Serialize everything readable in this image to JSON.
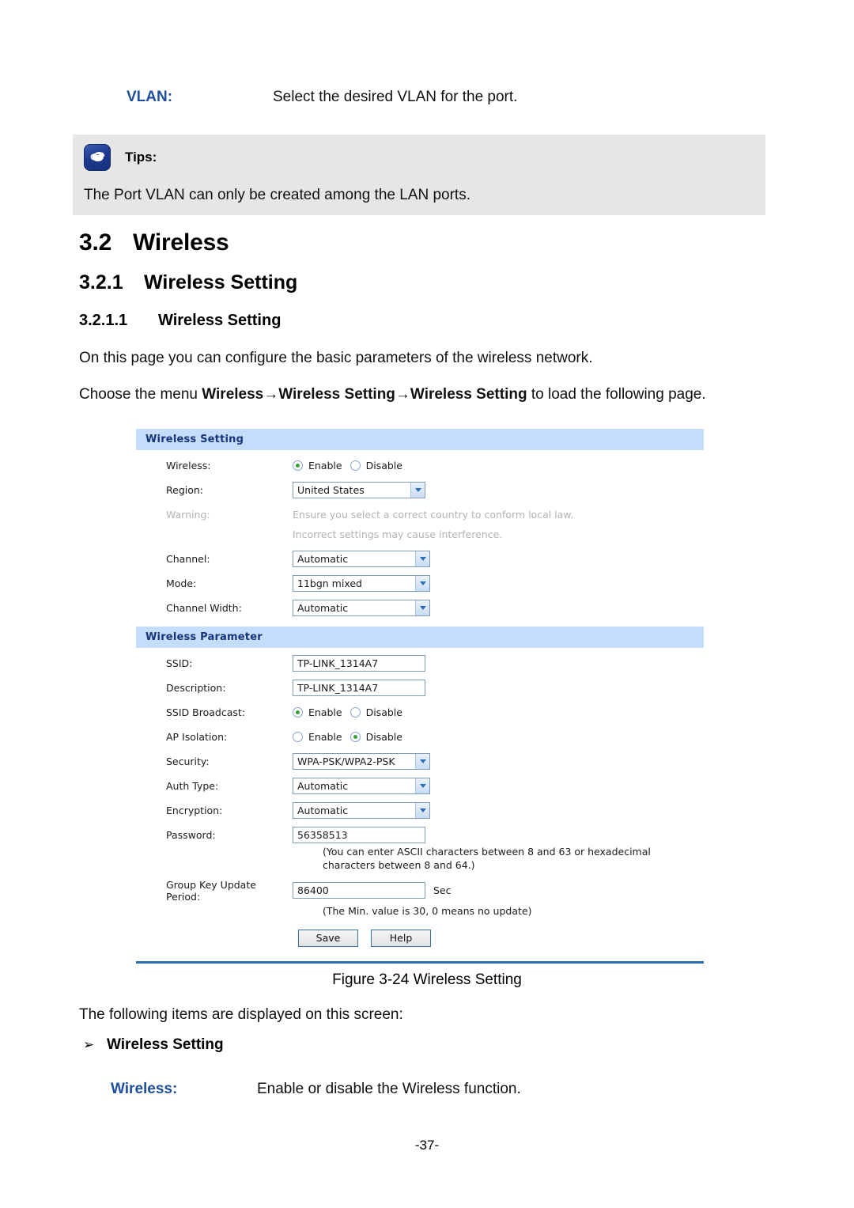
{
  "top_term": {
    "label": "VLAN:",
    "description": "Select the desired VLAN for the port."
  },
  "tips": {
    "icon": "pointing-hand-icon",
    "title": "Tips:",
    "body": "The Port VLAN can only be created among the LAN ports."
  },
  "headings": {
    "h2_num": "3.2",
    "h2_text": "Wireless",
    "h3_num": "3.2.1",
    "h3_text": "Wireless Setting",
    "h4_num": "3.2.1.1",
    "h4_text": "Wireless Setting"
  },
  "paragraphs": {
    "intro": "On this page you can configure the basic parameters of the wireless network.",
    "menu_prefix": "Choose the menu ",
    "menu_path_1": "Wireless",
    "menu_arrow_1": "→",
    "menu_path_2": "Wireless Setting",
    "menu_arrow_2": "→",
    "menu_path_3": "Wireless Setting",
    "menu_suffix": " to load the following page.",
    "following_items": "The following items are displayed on this screen:"
  },
  "figure": {
    "caption": "Figure 3-24 Wireless Setting"
  },
  "bullet": {
    "glyph": "➢",
    "text": "Wireless Setting"
  },
  "bottom_term": {
    "label": "Wireless:",
    "description": "Enable or disable the Wireless function."
  },
  "footer": {
    "page_number": "-37-"
  },
  "colors": {
    "term_blue": "#1f4e9c",
    "panel_header_bg": "#c6dcfb",
    "panel_header_text": "#14357a",
    "divider_blue": "#2d6cb5",
    "tips_bg": "#e6e6e6",
    "radio_dot_green": "#35a235",
    "input_border": "#7f9db9"
  },
  "ui": {
    "section1": {
      "title": "Wireless Setting",
      "wireless": {
        "label": "Wireless:",
        "options": [
          "Enable",
          "Disable"
        ],
        "selected": "Enable"
      },
      "region": {
        "label": "Region:",
        "value": "United States"
      },
      "warning": {
        "label": "Warning:",
        "line1": "Ensure you select a correct country to conform local law.",
        "line2": "Incorrect settings may cause interference."
      },
      "channel": {
        "label": "Channel:",
        "value": "Automatic"
      },
      "mode": {
        "label": "Mode:",
        "value": "11bgn mixed"
      },
      "channel_width": {
        "label": "Channel Width:",
        "value": "Automatic"
      }
    },
    "section2": {
      "title": "Wireless Parameter",
      "ssid": {
        "label": "SSID:",
        "value": "TP-LINK_1314A7"
      },
      "description": {
        "label": "Description:",
        "value": "TP-LINK_1314A7"
      },
      "ssid_broadcast": {
        "label": "SSID Broadcast:",
        "options": [
          "Enable",
          "Disable"
        ],
        "selected": "Enable"
      },
      "ap_isolation": {
        "label": "AP Isolation:",
        "options": [
          "Enable",
          "Disable"
        ],
        "selected": "Disable"
      },
      "security": {
        "label": "Security:",
        "value": "WPA-PSK/WPA2-PSK"
      },
      "auth_type": {
        "label": "Auth Type:",
        "value": "Automatic"
      },
      "encryption": {
        "label": "Encryption:",
        "value": "Automatic"
      },
      "password": {
        "label": "Password:",
        "value": "56358513",
        "hint_line1": "(You can enter ASCII characters between 8 and 63 or hexadecimal",
        "hint_line2": "characters between 8 and 64.)"
      },
      "group_key": {
        "label": "Group Key Update Period:",
        "value": "86400",
        "unit": "Sec",
        "hint": "(The Min. value is 30, 0 means no update)"
      },
      "buttons": {
        "save": "Save",
        "help": "Help"
      }
    }
  }
}
